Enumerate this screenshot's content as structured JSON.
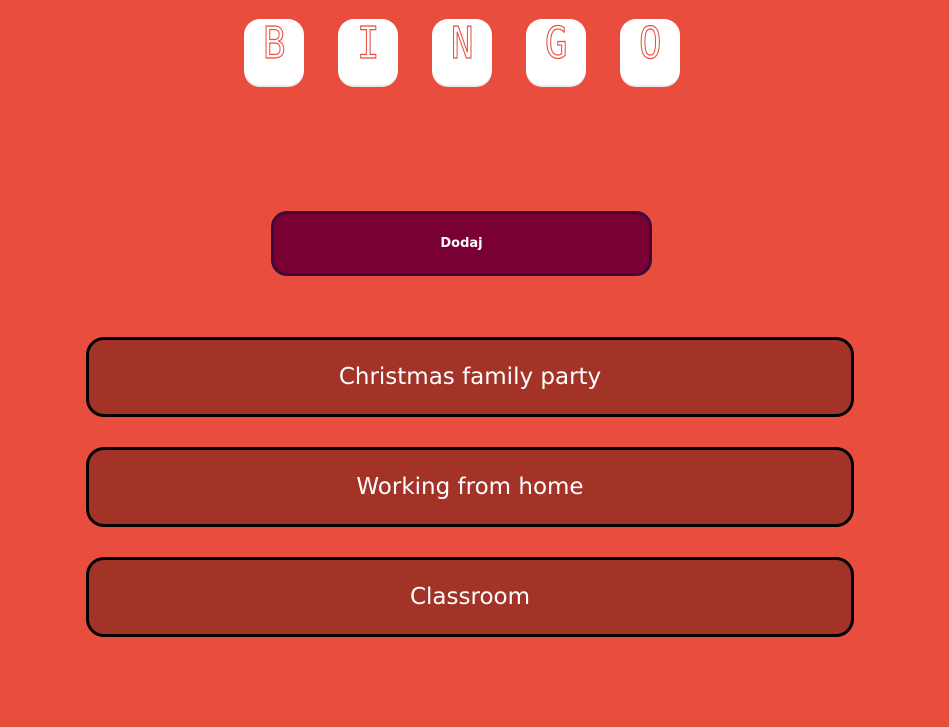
{
  "header": {
    "letters": [
      "B",
      "I",
      "N",
      "G",
      "O"
    ]
  },
  "actions": {
    "add_label": "Dodaj"
  },
  "boards": [
    {
      "label": "Christmas family party"
    },
    {
      "label": "Working from home"
    },
    {
      "label": "Classroom"
    }
  ],
  "colors": {
    "background": "#e84d3d",
    "tile": "#ffffff",
    "add_button": "#7a0034",
    "list_item": "#a33227"
  }
}
